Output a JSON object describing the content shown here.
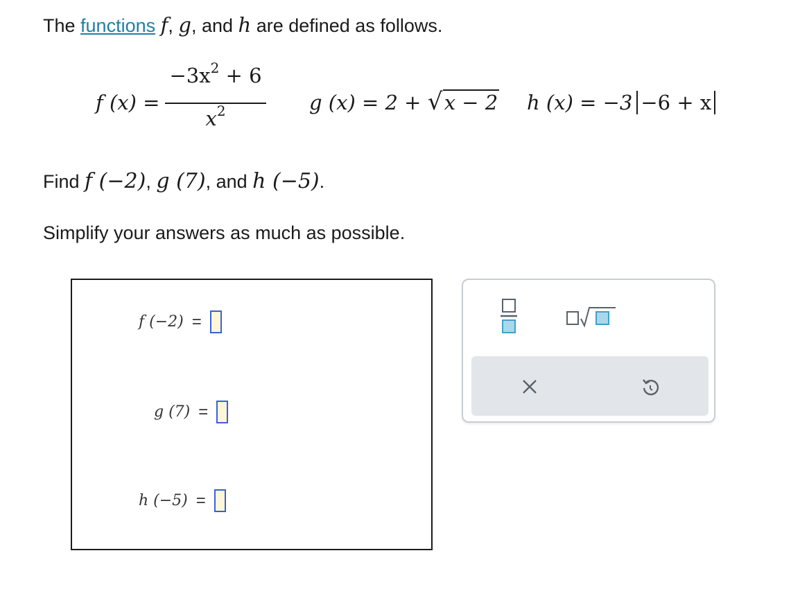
{
  "intro": {
    "prefix": "The ",
    "link": "functions",
    "var_f": "f",
    "comma1": ", ",
    "var_g": "g",
    "comma2": ", and ",
    "var_h": "h",
    "suffix": " are defined as follows."
  },
  "definitions": {
    "f_lhs": "f (x) =",
    "f_numerator": "−3x",
    "f_numerator_exp": "2",
    "f_numerator_tail": " + 6",
    "f_denominator": "x",
    "f_denominator_exp": "2",
    "g_lhs": "g (x) = 2 + ",
    "g_radicand": "x − 2",
    "h_lhs": "h (x) = −3",
    "h_abs": "−6 + x"
  },
  "find": {
    "prefix": "Find ",
    "f_call": "f (−2)",
    "sep1": ", ",
    "g_call": "g (7)",
    "sep2": ", and ",
    "h_call": "h (−5)",
    "suffix": "."
  },
  "simplify": "Simplify your answers as much as possible.",
  "answers": [
    {
      "label": "f (−2)",
      "equals": "=",
      "value": ""
    },
    {
      "label": "g (7)",
      "equals": "=",
      "value": ""
    },
    {
      "label": "h (−5)",
      "equals": "=",
      "value": ""
    }
  ],
  "palette": {
    "buttons": [
      "fraction-icon",
      "sqrt-icon"
    ],
    "actions": [
      "clear-icon",
      "undo-icon"
    ]
  },
  "colors": {
    "link": "#1f7fa6",
    "input_border": "#3c5fd6",
    "input_fill": "#fdf6d8",
    "icon_teal": "#3ea1c9",
    "action_bar": "#e2e6ea"
  }
}
